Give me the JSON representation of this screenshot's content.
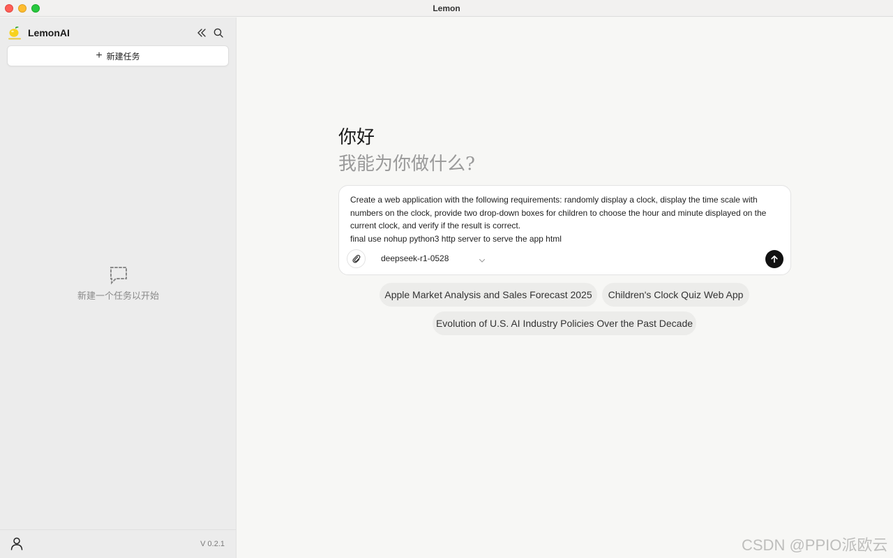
{
  "window": {
    "title": "Lemon"
  },
  "sidebar": {
    "brand_name": "LemonAI",
    "logo_text": "LEMON AI",
    "new_task_label": "新建任务",
    "empty_text": "新建一个任务以开始",
    "version": "V 0.2.1"
  },
  "main": {
    "greeting": "你好",
    "subtitle": "我能为你做什么?",
    "prompt": "Create a web application with the following requirements: randomly display a clock, display the time scale with numbers on the clock, provide two drop-down boxes for children to choose the hour and minute displayed on the current clock, and verify if the result is correct.\nfinal use nohup python3 http server to serve the app html",
    "model": "deepseek-r1-0528",
    "suggestions": [
      "Apple Market Analysis and Sales Forecast 2025",
      "Children's Clock Quiz Web App",
      "Evolution of U.S. AI Industry Policies Over the Past Decade"
    ]
  },
  "watermark": "CSDN @PPIO派欧云",
  "icons": {
    "collapse": "double-chevron-left-icon",
    "search": "search-icon",
    "plus": "plus-icon",
    "empty": "chat-bubble-dashed-icon",
    "user": "user-icon",
    "attach": "paperclip-icon",
    "dropdown": "chevron-down-icon",
    "send": "arrow-up-icon"
  },
  "colors": {
    "send_button": "#111111",
    "sidebar_bg": "#ececec",
    "main_bg": "#f7f7f5"
  }
}
